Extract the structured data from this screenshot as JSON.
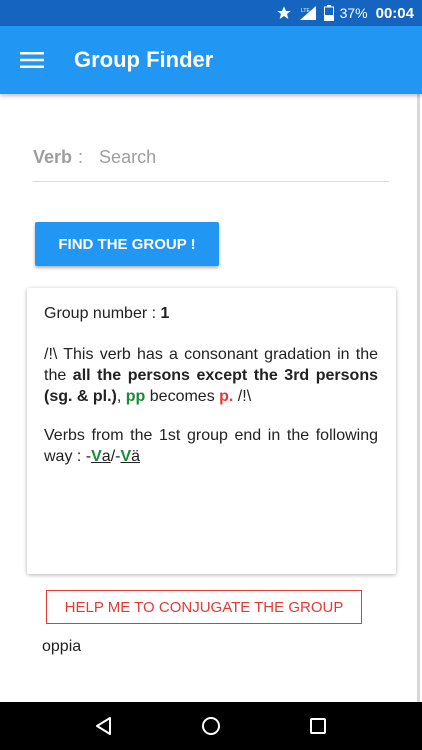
{
  "status_bar": {
    "network_label": "LTE",
    "battery": "37%",
    "time": "00:04"
  },
  "app_bar": {
    "title": "Group Finder",
    "menu_icon": "hamburger-menu-icon"
  },
  "search": {
    "label": "Verb",
    "colon": ":",
    "placeholder": "Search",
    "value": ""
  },
  "find_button": {
    "label": "FIND THE GROUP !"
  },
  "result_card": {
    "group_prefix": "Group number : ",
    "group_number": "1",
    "gradation": {
      "lead": "/!\\ This verb has a consonant gradation in the ",
      "the_word": "the ",
      "persons": "all the persons except the  3rd persons (sg. & pl.)",
      "comma": ", ",
      "from": "pp",
      "becomes": " becomes ",
      "to": "p.",
      "tail": " /!\\"
    },
    "ending": {
      "lead": "Verbs from the 1st group end in the following way : -",
      "v1": "V",
      "a1": "a",
      "slash": "/-",
      "v2": "V",
      "a2": "ä"
    },
    "help_button": "HELP ME TO CONJUGATE THE GROUP",
    "example_word": "oppia"
  },
  "colors": {
    "primary": "#2196f3",
    "status_bar": "#1565c0",
    "green": "#1b8a3a",
    "red": "#e53935"
  },
  "nav": {
    "back_icon": "back-triangle-icon",
    "home_icon": "home-circle-icon",
    "recents_icon": "recents-square-icon"
  }
}
